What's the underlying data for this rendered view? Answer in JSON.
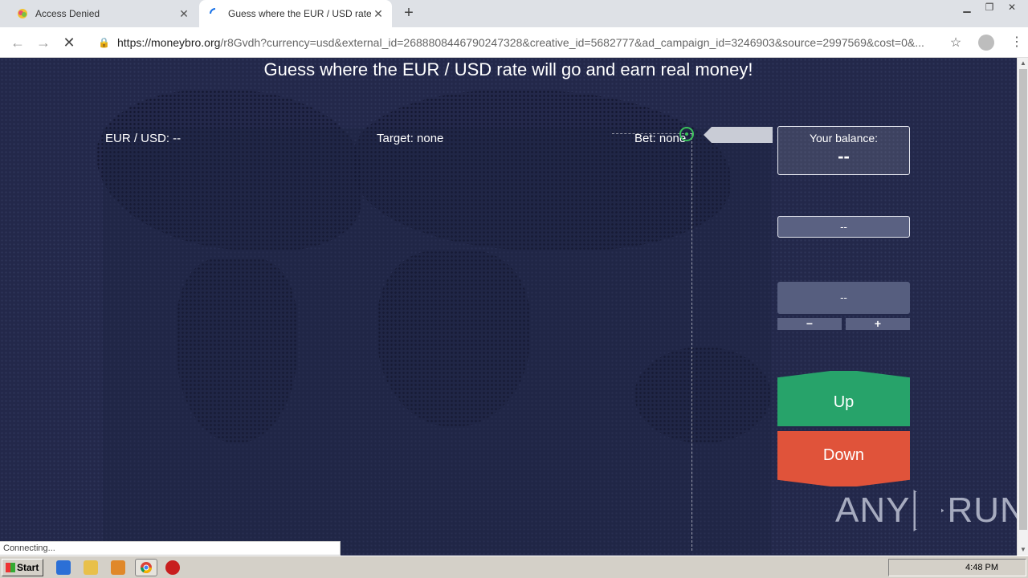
{
  "browser": {
    "tabs": [
      {
        "title": "Access Denied",
        "active": false
      },
      {
        "title": "Guess where the EUR / USD rate will",
        "active": true
      }
    ],
    "new_tab": "+",
    "url_host": "https://moneybro.org",
    "url_path": "/r8Gvdh?currency=usd&external_id=2688808446790247328&creative_id=5682777&ad_campaign_id=3246903&source=2997569&cost=0&...",
    "status_text": "Connecting..."
  },
  "page": {
    "headline": "Guess where the EUR / USD rate will go and earn real money!",
    "chart": {
      "pair_label": "EUR / USD: --",
      "target_label": "Target: none",
      "bet_label": "Bet: none"
    },
    "side": {
      "balance_label": "Your balance:",
      "balance_value": "--",
      "rate_value": "--",
      "amount_value": "--",
      "minus": "−",
      "plus": "+",
      "up_label": "Up",
      "down_label": "Down"
    },
    "watermark": {
      "left": "ANY",
      "right": "RUN"
    }
  },
  "taskbar": {
    "start_label": "Start",
    "clock": "4:48 PM"
  },
  "colors": {
    "page_bg": "#23284a",
    "up": "#27a36a",
    "down": "#e0533a",
    "target": "#3ac15a"
  }
}
